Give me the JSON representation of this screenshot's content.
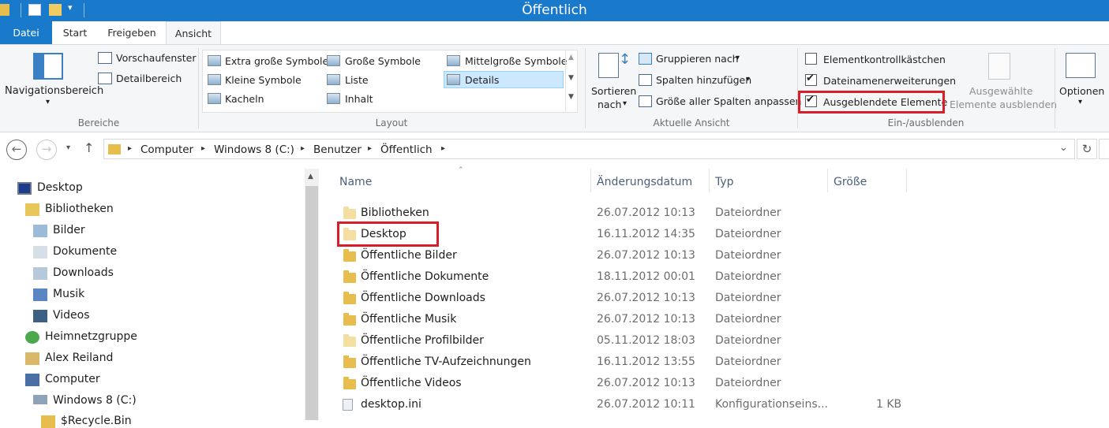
{
  "window": {
    "title": "Öffentlich"
  },
  "tabs": {
    "file": "Datei",
    "start": "Start",
    "share": "Freigeben",
    "view": "Ansicht"
  },
  "ribbon": {
    "panes": {
      "nav_pane": "Navigationsbereich",
      "preview": "Vorschaufenster",
      "details_pane": "Detailbereich",
      "group_label": "Bereiche"
    },
    "layout": {
      "extra_large": "Extra große Symbole",
      "large": "Große Symbole",
      "medium": "Mittelgroße Symbole",
      "small": "Kleine Symbole",
      "list": "Liste",
      "details": "Details",
      "tiles": "Kacheln",
      "content": "Inhalt",
      "group_label": "Layout"
    },
    "current_view": {
      "sort_line1": "Sortieren",
      "sort_line2": "nach",
      "group_by": "Gruppieren nach",
      "add_columns": "Spalten hinzufügen",
      "fit_columns": "Größe aller Spalten anpassen",
      "group_label": "Aktuelle Ansicht"
    },
    "show_hide": {
      "item_checkboxes": "Elementkontrollkästchen",
      "item_checkboxes_checked": false,
      "file_extensions": "Dateinamenerweiterungen",
      "file_extensions_checked": true,
      "hidden_items": "Ausgeblendete Elemente",
      "hidden_items_checked": true,
      "hide_selected_line1": "Ausgewählte",
      "hide_selected_line2": "Elemente ausblenden",
      "group_label": "Ein-/ausblenden"
    },
    "options": {
      "label": "Optionen"
    }
  },
  "address": {
    "crumbs": [
      "Computer",
      "Windows 8 (C:)",
      "Benutzer",
      "Öffentlich"
    ]
  },
  "nav": {
    "items": [
      {
        "label": "Desktop",
        "icon": "desktop-icon"
      },
      {
        "label": "Bibliotheken",
        "icon": "libraries-icon"
      },
      {
        "label": "Bilder",
        "icon": "pictures-icon"
      },
      {
        "label": "Dokumente",
        "icon": "documents-icon"
      },
      {
        "label": "Downloads",
        "icon": "downloads-icon"
      },
      {
        "label": "Musik",
        "icon": "music-icon"
      },
      {
        "label": "Videos",
        "icon": "videos-icon"
      },
      {
        "label": "Heimnetzgruppe",
        "icon": "homegroup-icon"
      },
      {
        "label": "Alex Reiland",
        "icon": "user-icon"
      },
      {
        "label": "Computer",
        "icon": "computer-icon"
      },
      {
        "label": "Windows 8 (C:)",
        "icon": "drive-icon"
      },
      {
        "label": "$Recycle.Bin",
        "icon": "folder-icon"
      }
    ]
  },
  "files": {
    "columns": {
      "name": "Name",
      "date": "Änderungsdatum",
      "type": "Typ",
      "size": "Größe"
    },
    "rows": [
      {
        "name": "Bibliotheken",
        "date": "26.07.2012 10:13",
        "type": "Dateiordner",
        "size": ""
      },
      {
        "name": "Desktop",
        "date": "16.11.2012 14:35",
        "type": "Dateiordner",
        "size": ""
      },
      {
        "name": "Öffentliche Bilder",
        "date": "26.07.2012 10:13",
        "type": "Dateiordner",
        "size": ""
      },
      {
        "name": "Öffentliche Dokumente",
        "date": "18.11.2012 00:01",
        "type": "Dateiordner",
        "size": ""
      },
      {
        "name": "Öffentliche Downloads",
        "date": "26.07.2012 10:13",
        "type": "Dateiordner",
        "size": ""
      },
      {
        "name": "Öffentliche Musik",
        "date": "26.07.2012 10:13",
        "type": "Dateiordner",
        "size": ""
      },
      {
        "name": "Öffentliche Profilbilder",
        "date": "05.11.2012 18:03",
        "type": "Dateiordner",
        "size": ""
      },
      {
        "name": "Öffentliche TV-Aufzeichnungen",
        "date": "16.11.2012 13:55",
        "type": "Dateiordner",
        "size": ""
      },
      {
        "name": "Öffentliche Videos",
        "date": "26.07.2012 10:13",
        "type": "Dateiordner",
        "size": ""
      },
      {
        "name": "desktop.ini",
        "date": "26.07.2012 10:11",
        "type": "Konfigurationseins...",
        "size": "1 KB"
      }
    ]
  },
  "colors": {
    "accent": "#1979ca",
    "highlight": "#d81e28",
    "folder": "#e7be4e"
  }
}
